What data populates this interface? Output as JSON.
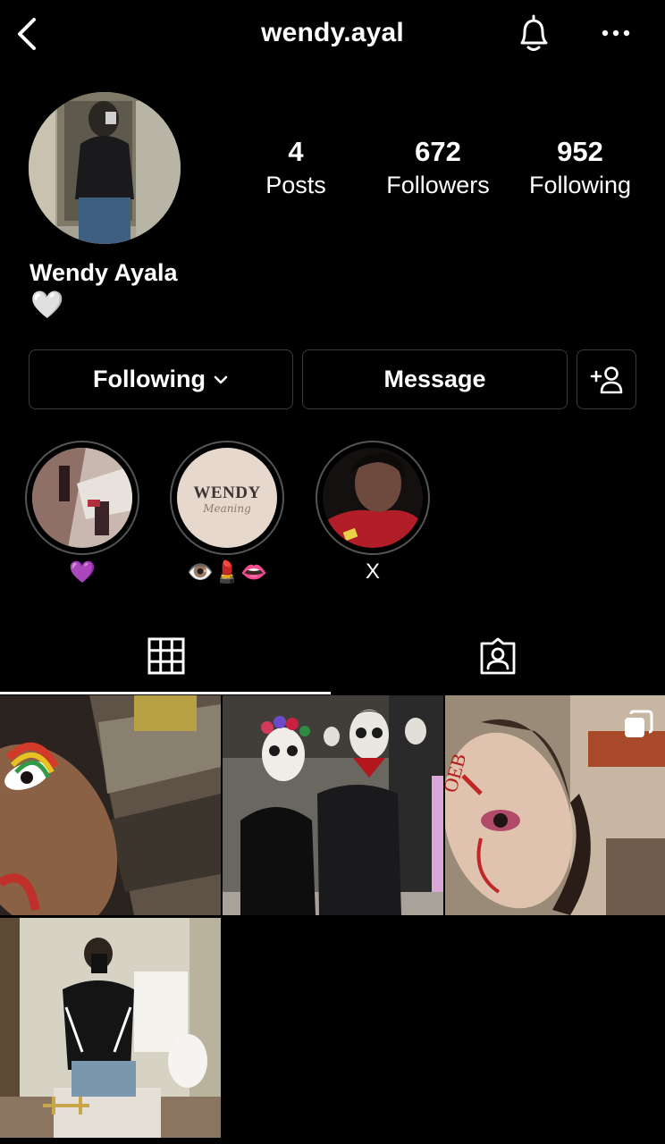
{
  "header": {
    "username": "wendy.ayal",
    "back_icon": "chevron-left-icon",
    "bell_icon": "bell-icon",
    "more_icon": "more-horizontal-icon"
  },
  "profile": {
    "display_name": "Wendy Ayala",
    "bio": "🤍",
    "stats": [
      {
        "value": "4",
        "label": "Posts"
      },
      {
        "value": "672",
        "label": "Followers"
      },
      {
        "value": "952",
        "label": "Following"
      }
    ]
  },
  "actions": {
    "following_label": "Following",
    "message_label": "Message",
    "add_user_icon": "add-user-icon"
  },
  "highlights": [
    {
      "label": "💜"
    },
    {
      "label": "👁️💄👄",
      "cover_title": "WENDY",
      "cover_subtitle": "Meaning"
    },
    {
      "label": "X"
    }
  ],
  "tabs": [
    {
      "name": "grid",
      "icon": "grid-icon",
      "active": true
    },
    {
      "name": "tagged",
      "icon": "tagged-user-icon",
      "active": false
    }
  ],
  "colors": {
    "background": "#000000",
    "text": "#ffffff",
    "button_border": "#3a3a3a"
  }
}
